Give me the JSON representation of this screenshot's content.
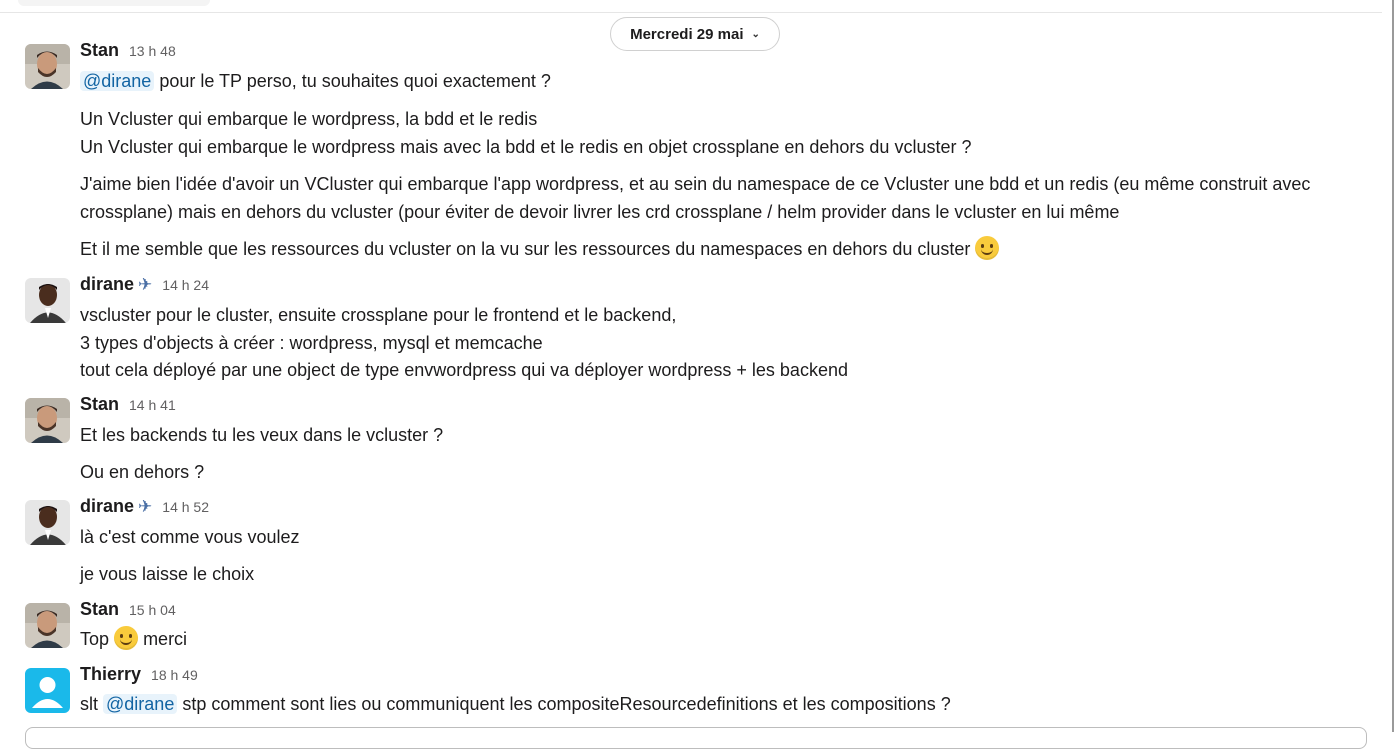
{
  "date_divider": {
    "label": "Mercredi 29 mai"
  },
  "messages": [
    {
      "author": "Stan",
      "time": "13 h 48",
      "lines": {
        "l1_mention": "@dirane",
        "l1_text": " pour le TP perso, tu souhaites quoi exactement ?",
        "l2": "Un Vcluster qui embarque le wordpress, la bdd et le redis",
        "l3": "Un Vcluster qui embarque le wordpress mais avec la bdd et le redis en objet crossplane en dehors du vcluster ?",
        "l4": "J'aime bien l'idée d'avoir un VCluster qui embarque l'app wordpress, et au sein du namespace de ce Vcluster une bdd et un redis (eu même construit avec",
        "l5": "crossplane) mais en dehors du vcluster (pour éviter de devoir livrer les crd crossplane / helm provider dans le vcluster en lui même",
        "l6": "Et il me semble que les ressources du vcluster on la vu sur les ressources du namespaces en dehors du cluster"
      }
    },
    {
      "author": "dirane",
      "time": "14 h 24",
      "lines": {
        "l1": "vscluster pour le cluster, ensuite crossplane pour le frontend et le backend,",
        "l2": "3 types d'objects à créer : wordpress, mysql et memcache",
        "l3": "tout cela déployé par une object de type envwordpress qui va déployer wordpress + les backend"
      }
    },
    {
      "author": "Stan",
      "time": "14 h 41",
      "lines": {
        "l1": "Et les backends tu les veux dans le vcluster ?",
        "l2": "Ou en dehors ?"
      }
    },
    {
      "author": "dirane",
      "time": "14 h 52",
      "lines": {
        "l1": "là c'est comme vous voulez",
        "l2": "je vous laisse le choix"
      }
    },
    {
      "author": "Stan",
      "time": "15 h 04",
      "lines": {
        "l1a": "Top",
        "l1b": "merci"
      }
    },
    {
      "author": "Thierry",
      "time": "18 h 49",
      "lines": {
        "l1a": "slt",
        "l1_mention": "@dirane",
        "l1b": " stp comment sont lies ou communiquent les compositeResourcedefinitions et les compositions ?"
      }
    }
  ],
  "icons": {
    "airplane": "airplane-icon",
    "smile": "slightly-smiling-face-emoji"
  }
}
